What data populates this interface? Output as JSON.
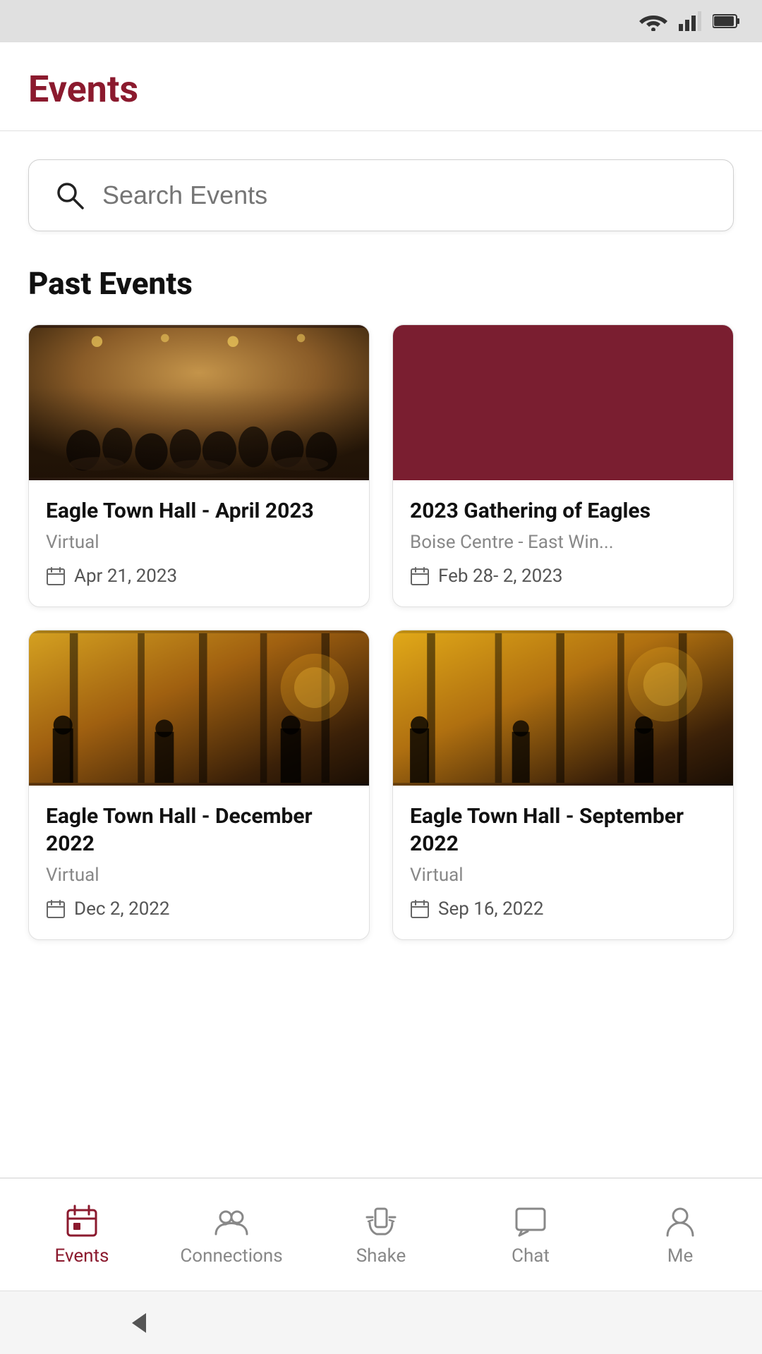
{
  "statusBar": {
    "wifi": "wifi-icon",
    "signal": "signal-icon",
    "battery": "battery-icon"
  },
  "header": {
    "title": "Events"
  },
  "search": {
    "placeholder": "Search Events"
  },
  "pastEvents": {
    "sectionTitle": "Past Events",
    "events": [
      {
        "id": "eagle-town-hall-april-2023",
        "title": "Eagle Town Hall - April 2023",
        "location": "Virtual",
        "date": "Apr 21, 2023",
        "imageType": "photo"
      },
      {
        "id": "gathering-of-eagles-2023",
        "title": "2023 Gathering of Eagles",
        "location": "Boise Centre - East Win...",
        "date": "Feb 28- 2, 2023",
        "imageType": "placeholder"
      },
      {
        "id": "eagle-town-hall-dec-2022",
        "title": "Eagle Town Hall - December 2022",
        "location": "Virtual",
        "date": "Dec  2, 2022",
        "imageType": "photo2"
      },
      {
        "id": "eagle-town-hall-sep-2022",
        "title": "Eagle Town Hall - September 2022",
        "location": "Virtual",
        "date": "Sep 16, 2022",
        "imageType": "photo3"
      }
    ]
  },
  "bottomNav": {
    "items": [
      {
        "id": "events",
        "label": "Events",
        "active": true
      },
      {
        "id": "connections",
        "label": "Connections",
        "active": false
      },
      {
        "id": "shake",
        "label": "Shake",
        "active": false
      },
      {
        "id": "chat",
        "label": "Chat",
        "active": false
      },
      {
        "id": "me",
        "label": "Me",
        "active": false
      }
    ]
  },
  "colors": {
    "brand": "#8b1a2e",
    "navActive": "#8b1a2e",
    "navInactive": "#888888"
  }
}
